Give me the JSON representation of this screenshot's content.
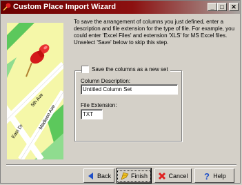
{
  "window": {
    "title": "Custom Place Import Wizard",
    "controls": {
      "minimize": "_",
      "maximize": "□",
      "close": "✕"
    }
  },
  "description": "To save the arrangement of columns you just defined, enter a description and file extension for the type of file. For example, you could enter 'Excel Files' and extension 'XLS' for MS Excel files. Unselect 'Save' below to skip this step.",
  "illustration": {
    "streets": [
      "5th Ave",
      "Madison Ave",
      "East Dr"
    ]
  },
  "save_group": {
    "checkbox_label": "Save the columns as a new set",
    "checked": false,
    "column_description": {
      "label": "Column Description:",
      "value": "Untitled Column Set"
    },
    "file_extension": {
      "label": "File Extension:",
      "value": "TXT"
    }
  },
  "buttons": {
    "back": "Back",
    "finish": "Finish",
    "cancel": "Cancel",
    "help": "Help"
  },
  "colors": {
    "titlebar": "#8c1010",
    "face": "#d4d0c8",
    "map_bg": "#f5f7a8",
    "pin": "#d41a1a"
  }
}
